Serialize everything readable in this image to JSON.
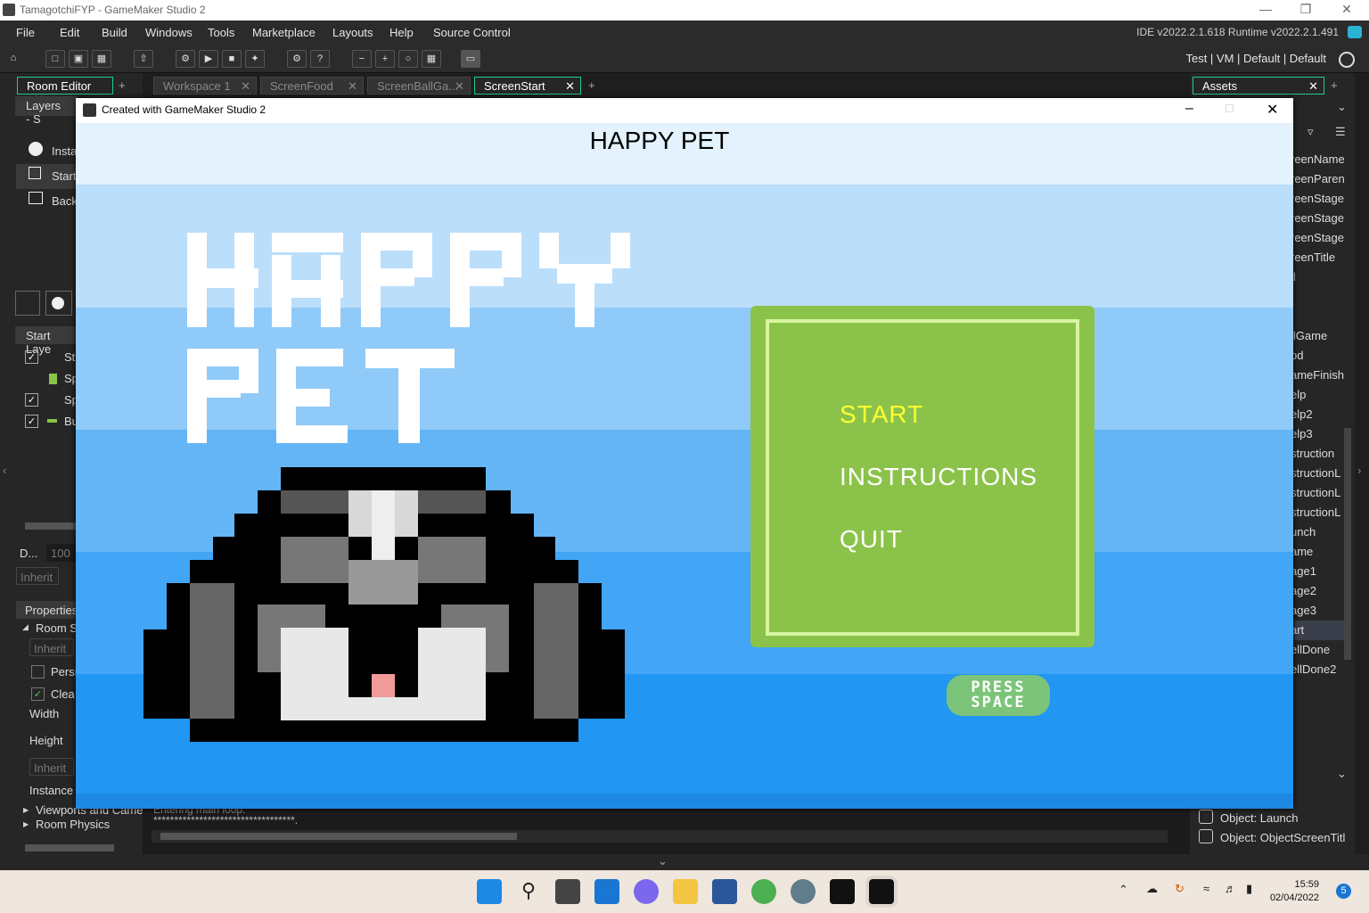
{
  "window": {
    "title": "TamagotchiFYP - GameMaker Studio 2"
  },
  "menu": [
    "File",
    "Edit",
    "Build",
    "Windows",
    "Tools",
    "Marketplace",
    "Layouts",
    "Help",
    "Source Control"
  ],
  "ide_version": "IDE v2022.2.1.618  Runtime v2022.2.1.491",
  "targets": "Test | VM | Default | Default",
  "left_tabs": {
    "room_editor": "Room Editor"
  },
  "workspace_tabs": [
    "Workspace 1",
    "ScreenFood",
    "ScreenBallGa...",
    "ScreenStart"
  ],
  "assets_tab": "Assets",
  "left_panel": {
    "layers_label": "Layers - S",
    "layer_items": [
      "Insta",
      "Start",
      "Back"
    ],
    "start_layer": "Start Laye",
    "start_layer_rows": [
      "St",
      "Sp",
      "Sp",
      "Bu"
    ],
    "depth_label": "D...",
    "depth_value": "100",
    "inherit": "Inherit",
    "properties": "Properties",
    "room_settings": "Room Se",
    "persistent": "Persi",
    "clear": "Clea",
    "width": "Width",
    "height": "Height",
    "instance": "Instance",
    "viewports": "Viewports and Came",
    "room_physics": "Room Physics"
  },
  "right_panel": {
    "asset_items": [
      "reenName",
      "reenParen",
      "reenStage",
      "reenStage",
      "reenStage",
      "reenTitle",
      "ll",
      "llGame",
      "od",
      "ameFinish",
      "elp",
      "elp2",
      "elp3",
      "struction",
      "structionL",
      "structionL",
      "structionL",
      "unch",
      "ame",
      "age1",
      "age2",
      "age3",
      "art",
      "ellDone",
      "ellDone2"
    ],
    "bottom_items": [
      "Object: Launch",
      "Object: ObjectScreenTitl"
    ]
  },
  "output": {
    "line1": "Entering main loop.",
    "line2": "**********************************."
  },
  "game_window": {
    "title": "Created with GameMaker Studio 2",
    "heading": "HAPPY PET",
    "logo_text": "HAPPY PET",
    "menu_items": [
      "START",
      "INSTRUCTIONS",
      "QUIT"
    ],
    "press_space": [
      "PRESS",
      "SPACE"
    ]
  },
  "colors": {
    "start_highlight": "#ffff33",
    "panel_green": "#8bc34a"
  },
  "clock": {
    "time": "15:59",
    "date": "02/04/2022"
  },
  "notifications": "5"
}
